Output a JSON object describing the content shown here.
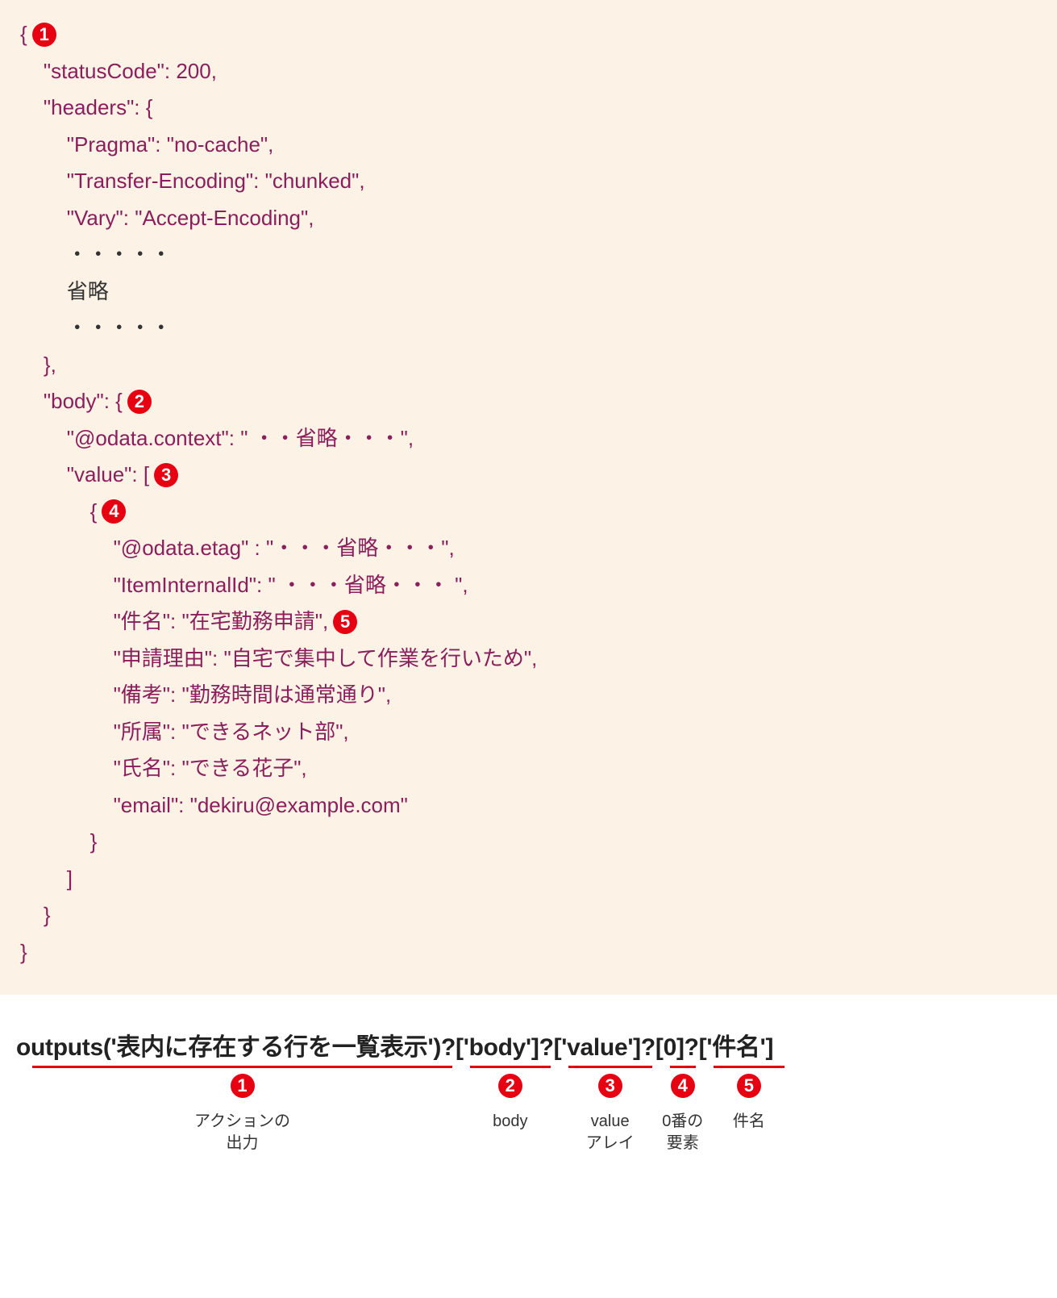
{
  "code": {
    "l1": "{",
    "l2": "    \"statusCode\": 200,",
    "l3": "    \"headers\": {",
    "l4": "        \"Pragma\": \"no-cache\",",
    "l5": "        \"Transfer-Encoding\": \"chunked\",",
    "l6": "        \"Vary\": \"Accept-Encoding\",",
    "dots1": "        ・・・・・",
    "omit": "        省略",
    "dots2": "        ・・・・・",
    "l7": "    },",
    "l8p1": "    \"body\": {",
    "l9": "        \"@odata.context\": \" ・・省略・・・\",",
    "l10p1": "        \"value\": [",
    "l11": "            {",
    "l12": "                \"@odata.etag\" : \"・・・省略・・・\",",
    "l13": "                \"ItemInternalId\": \" ・・・省略・・・ \",",
    "l14p1": "                \"件名\": \"在宅勤務申請\",",
    "l15": "                \"申請理由\": \"自宅で集中して作業を行いため\",",
    "l16": "                \"備考\": \"勤務時間は通常通り\",",
    "l17": "                \"所属\": \"できるネット部\",",
    "l18": "                \"氏名\": \"できる花子\",",
    "l19": "                \"email\": \"dekiru@example.com\"",
    "l20": "            }",
    "l21": "        ]",
    "l22": "    }",
    "l23": "}"
  },
  "badges": {
    "b1": "1",
    "b2": "2",
    "b3": "3",
    "b4": "4",
    "b5": "5"
  },
  "expr": {
    "p1": "outputs('表内に存在する行を一覧表示')",
    "p2": "?['body']",
    "p3": "?['value']",
    "p4": "?[0]",
    "p5": "?['件名']"
  },
  "labels": {
    "l1a": "アクションの",
    "l1b": "出力",
    "l2": "body",
    "l3a": "value",
    "l3b": "アレイ",
    "l4a": "0番の",
    "l4b": "要素",
    "l5": "件名"
  }
}
